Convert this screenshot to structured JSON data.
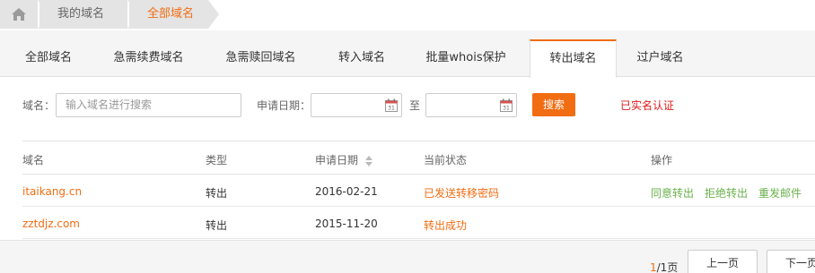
{
  "breadcrumb": {
    "home_icon": "home-icon",
    "items": [
      "我的域名",
      "全部域名"
    ]
  },
  "tabs": [
    {
      "label": "全部域名",
      "active": false
    },
    {
      "label": "急需续费域名",
      "active": false
    },
    {
      "label": "急需赎回域名",
      "active": false
    },
    {
      "label": "转入域名",
      "active": false
    },
    {
      "label": "批量whois保护",
      "active": false
    },
    {
      "label": "转出域名",
      "active": true
    },
    {
      "label": "过户域名",
      "active": false
    }
  ],
  "filters": {
    "domain_label": "域名：",
    "domain_placeholder": "输入域名进行搜索",
    "date_label": "申请日期：",
    "date_sep": "至",
    "search_label": "搜索",
    "realname_link": "已实名认证"
  },
  "table": {
    "headers": [
      "域名",
      "类型",
      "申请日期",
      "当前状态",
      "操作"
    ],
    "rows": [
      {
        "domain": "itaikang.cn",
        "type": "转出",
        "date": "2016-02-21",
        "status": "已发送转移密码",
        "actions": [
          "同意转出",
          "拒绝转出",
          "重发邮件"
        ]
      },
      {
        "domain": "zztdjz.com",
        "type": "转出",
        "date": "2015-11-20",
        "status": "转出成功",
        "actions": []
      }
    ]
  },
  "pagination": {
    "current": "1",
    "total": "/1页",
    "prev_label": "上一页",
    "next_label": "下一页"
  },
  "colors": {
    "accent": "#f26c11",
    "link_green": "#6ab04c",
    "realname_red": "#e01b1b"
  }
}
